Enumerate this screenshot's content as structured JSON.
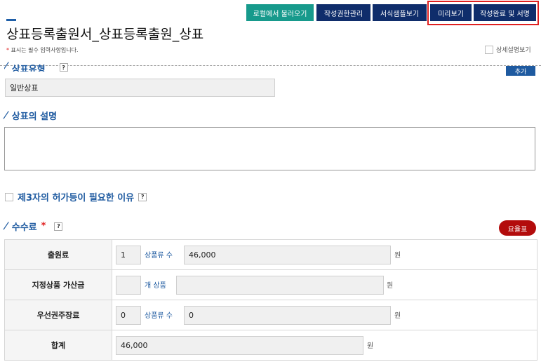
{
  "header": {
    "buttons": [
      {
        "label": "로컬에서 불러오기",
        "color": "#179a8c"
      },
      {
        "label": "작성권한관리",
        "color": "#0f2d6b"
      },
      {
        "label": "서식샘플보기",
        "color": "#0f2d6b"
      },
      {
        "label": "미리보기",
        "color": "#0f2d6b"
      },
      {
        "label": "작성완료 및 서명",
        "color": "#0f2d6b"
      }
    ]
  },
  "page": {
    "title": "상표등록출원서_상표등록출원_상표",
    "required_star": "*",
    "required_note": "표시는 필수 입력사항입니다.",
    "detail_toggle_label": "상세설명보기"
  },
  "trademark_type": {
    "heading": "상표유형",
    "help": "?",
    "add_button": "추가",
    "value": "일반상표"
  },
  "description": {
    "heading": "상표의 설명",
    "value": ""
  },
  "third_party": {
    "heading": "제3자의 허가등이 필요한 이유",
    "help": "?"
  },
  "fees": {
    "heading": "수수료",
    "required_star": "*",
    "help": "?",
    "fee_table_button": "요율표",
    "rows": [
      {
        "label": "출원료",
        "count": "1",
        "count_label": "상품류 수",
        "amount": "46,000",
        "unit": "원"
      },
      {
        "label": "지정상품 가산금",
        "count": "",
        "count_label": "개 상품",
        "amount": "",
        "unit": "원"
      },
      {
        "label": "우선권주장료",
        "count": "0",
        "count_label": "상품류 수",
        "amount": "0",
        "unit": "원"
      }
    ],
    "total": {
      "label": "합계",
      "amount": "46,000",
      "unit": "원"
    }
  },
  "colors": {
    "accent": "#1e5aa0",
    "teal": "#179a8c",
    "navy": "#0f2d6b",
    "highlight": "#e02020",
    "fee_button": "#b30c0c"
  }
}
